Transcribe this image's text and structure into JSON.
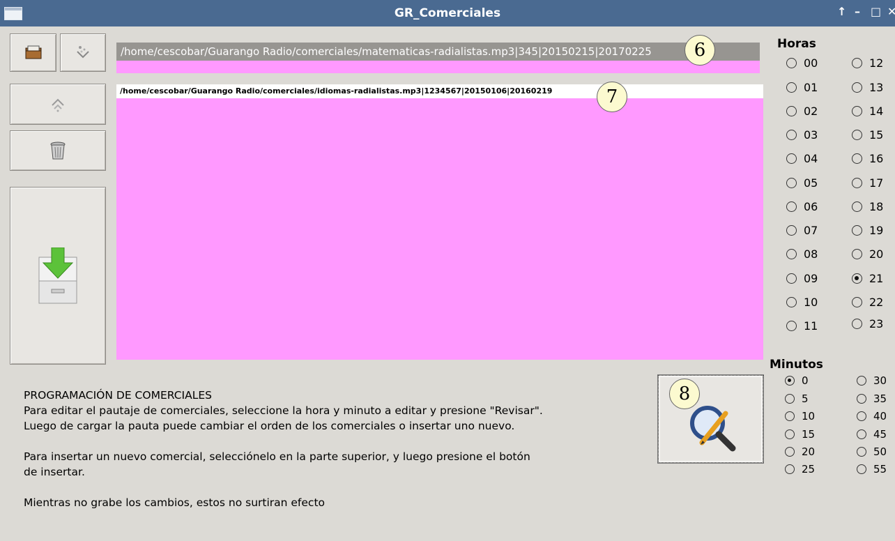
{
  "window": {
    "title": "GR_Comerciales",
    "controls": [
      "↑",
      "–",
      "□",
      "✕"
    ]
  },
  "toolbar": {
    "open_icon": "folder-icon",
    "add_icon": "add-sparkle-icon",
    "up_icon": "move-up-icon",
    "trash_icon": "trash-icon",
    "insert_icon": "insert-drawer-icon"
  },
  "top_list": {
    "selected_item": "/home/cescobar/Guarango Radio/comerciales/matematicas-radialistas.mp3|345|20150215|20170225"
  },
  "schedule_list": {
    "items": [
      "/home/cescobar/Guarango Radio/comerciales/idiomas-radialistas.mp3|1234567|20150106|20160219"
    ]
  },
  "callouts": {
    "six": "6",
    "seven": "7",
    "eight": "8"
  },
  "horas": {
    "label": "Horas",
    "left": [
      "00",
      "01",
      "02",
      "03",
      "04",
      "05",
      "06",
      "07",
      "08",
      "09",
      "10",
      "11"
    ],
    "right": [
      "12",
      "13",
      "14",
      "15",
      "16",
      "17",
      "18",
      "19",
      "20",
      "21",
      "22",
      "23"
    ],
    "selected": "21"
  },
  "minutos": {
    "label": "Minutos",
    "left": [
      "0",
      "5",
      "10",
      "15",
      "20",
      "25"
    ],
    "right": [
      "30",
      "35",
      "40",
      "45",
      "50",
      "55"
    ],
    "selected": "0"
  },
  "info": {
    "heading": "PROGRAMACIÓN DE COMERCIALES",
    "para1": "Para editar el pautaje de comerciales, seleccione la hora y minuto a editar y presione \"Revisar\". Luego de cargar la pauta puede cambiar el orden de los comerciales o insertar uno nuevo.",
    "para2": "Para insertar un nuevo comercial, selecciónelo en la parte superior, y luego presione el botón de insertar.",
    "para3": "Mientras no grabe los cambios, estos no surtiran efecto"
  },
  "review_button": {
    "icon": "magnifier-pencil-icon"
  }
}
